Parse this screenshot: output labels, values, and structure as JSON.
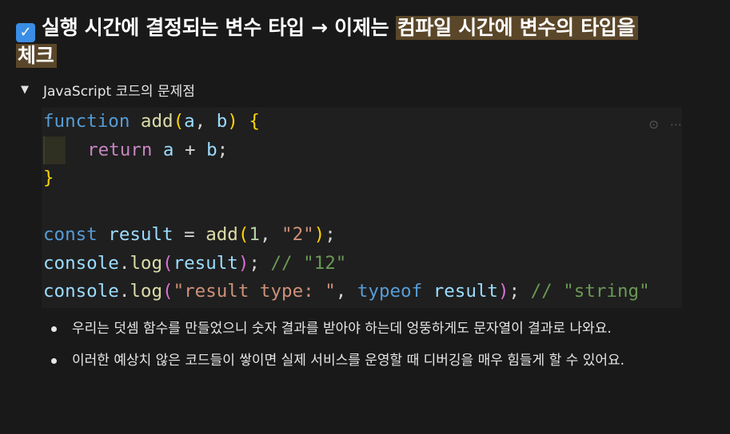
{
  "heading": {
    "part1": "실행 시간에 결정되는 변수 타입 → 이제는 ",
    "highlight1": "컴파일 시간에 변수의 타입을",
    "highlight2": "체크"
  },
  "toggle": {
    "label": "JavaScript 코드의 문제점"
  },
  "code": {
    "l1_kw": "function",
    "l1_fn": "add",
    "l1_open": "(",
    "l1_p1": "a",
    "l1_comma": ", ",
    "l1_p2": "b",
    "l1_close": ")",
    "l1_brace": "{",
    "l2_kw": "return",
    "l2_a": "a",
    "l2_plus": " + ",
    "l2_b": "b",
    "l2_semi": ";",
    "l3_brace": "}",
    "l5_kw": "const",
    "l5_var": "result",
    "l5_eq": " = ",
    "l5_fn": "add",
    "l5_open": "(",
    "l5_num": "1",
    "l5_comma": ", ",
    "l5_str": "\"2\"",
    "l5_close": ")",
    "l5_semi": ";",
    "l6_obj": "console",
    "l6_dot": ".",
    "l6_fn": "log",
    "l6_open": "(",
    "l6_arg": "result",
    "l6_close": ")",
    "l6_semi": "; ",
    "l6_cm": "// \"12\"",
    "l7_obj": "console",
    "l7_dot": ".",
    "l7_fn": "log",
    "l7_open": "(",
    "l7_str": "\"result type: \"",
    "l7_comma": ", ",
    "l7_kw": "typeof",
    "l7_arg": "result",
    "l7_close": ")",
    "l7_semi": "; ",
    "l7_cm": "// \"string\""
  },
  "bullets": [
    "우리는 덧셈 함수를 만들었으니 숫자 결과를 받아야 하는데 엉뚱하게도 문자열이 결과로 나와요.",
    "이러한 예상치 않은 코드들이 쌓이면 실제 서비스를 운영할 때 디버깅을 매우 힘들게 할 수 있어요."
  ],
  "icons": {
    "check": "checkbox-checked-icon",
    "toggle": "triangle-down-icon"
  }
}
